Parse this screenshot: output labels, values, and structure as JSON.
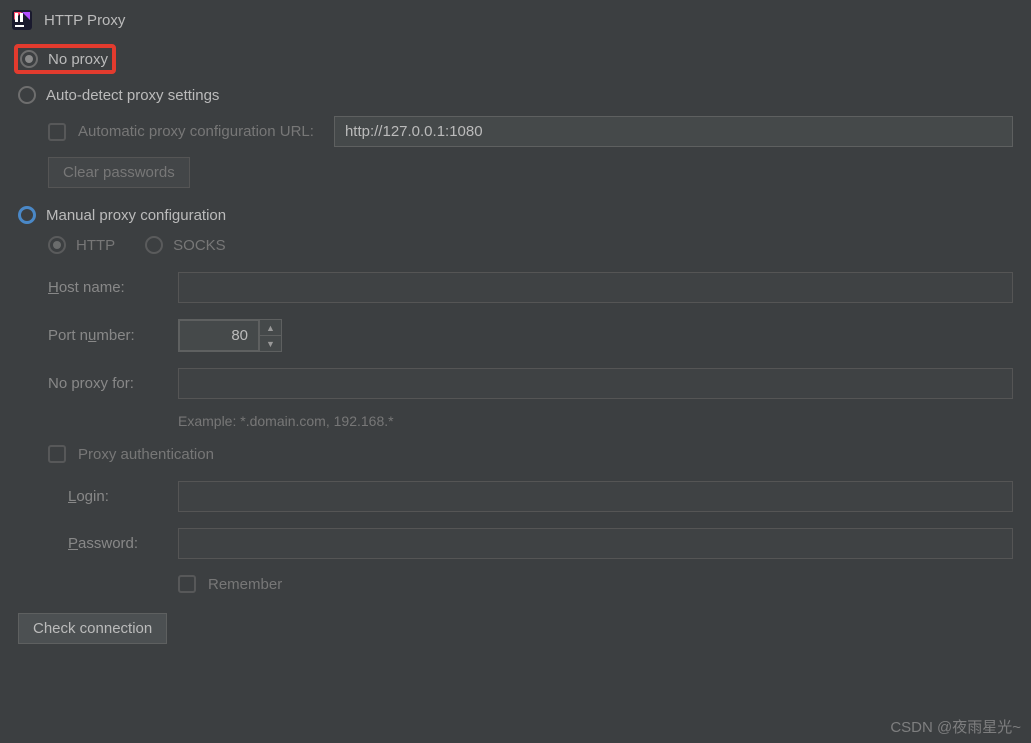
{
  "window": {
    "title": "HTTP Proxy"
  },
  "options": {
    "no_proxy": "No proxy",
    "auto_detect": "Auto-detect proxy settings",
    "manual": "Manual proxy configuration"
  },
  "auto": {
    "pac_label": "Automatic proxy configuration URL:",
    "pac_url": "http://127.0.0.1:1080",
    "clear_passwords": "Clear passwords"
  },
  "manual": {
    "protocol_http": "HTTP",
    "protocol_socks": "SOCKS",
    "host_label_pre": "H",
    "host_label_post": "ost name:",
    "host_value": "",
    "port_label_pre": "Port n",
    "port_label_post": "umber:",
    "port_value": "80",
    "noproxy_label": "No proxy for:",
    "noproxy_value": "",
    "example": "Example: *.domain.com, 192.168.*",
    "auth_label_pre": "Proxy a",
    "auth_label_post": "uthentication",
    "login_label_pre": "L",
    "login_label_post": "ogin:",
    "login_value": "",
    "password_label_pre": "P",
    "password_label_post": "assword:",
    "password_value": "",
    "remember_label_pre": "R",
    "remember_label_post": "emember"
  },
  "buttons": {
    "check_connection": "Check connection"
  },
  "watermark": "CSDN @夜雨星光~"
}
